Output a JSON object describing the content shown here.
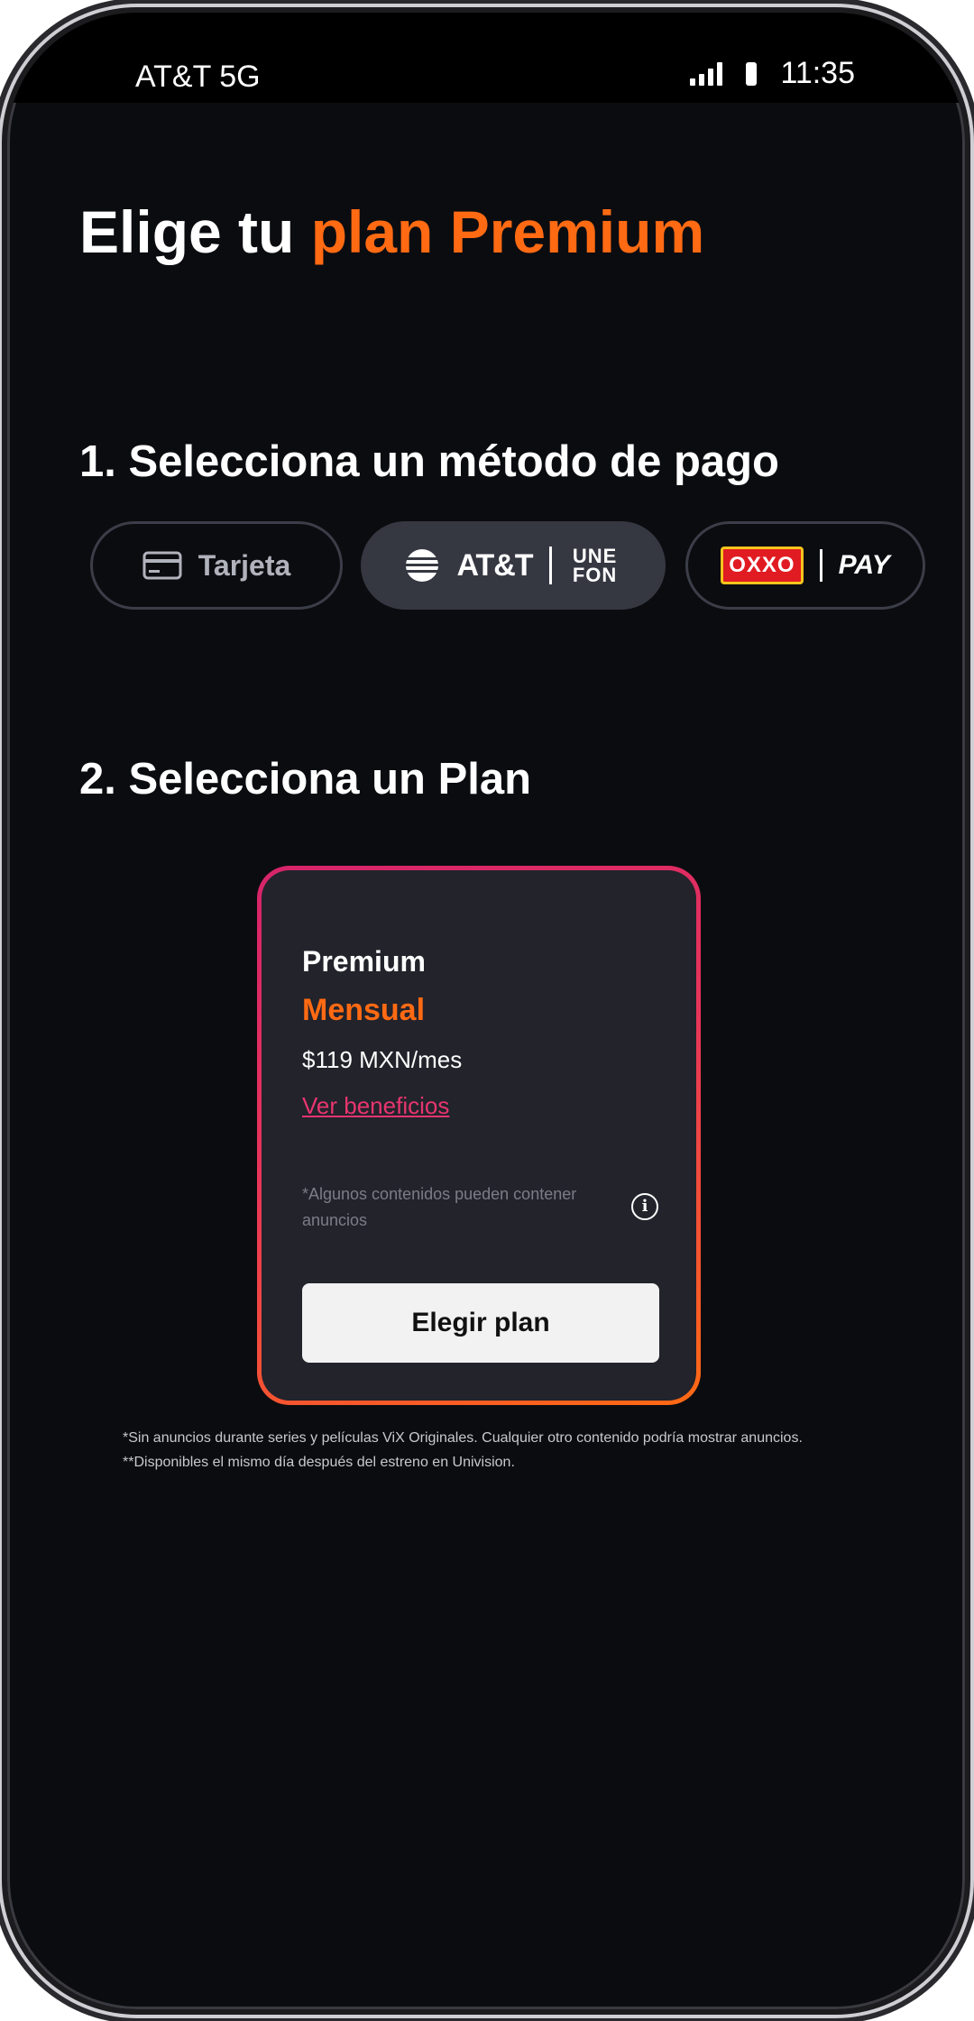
{
  "status_bar": {
    "carrier": "AT&T 5G",
    "time": "11:35"
  },
  "title": {
    "prefix": "Elige tu ",
    "accent": "plan Premium"
  },
  "step1": {
    "heading": "1. Selecciona un método de pago",
    "options": [
      {
        "label": "Tarjeta",
        "icon": "credit-card-icon",
        "selected": false
      },
      {
        "brand": "AT&T",
        "sub_brand": "UNE FON",
        "selected": true
      },
      {
        "brand": "OXXO",
        "sub_brand": "PAY",
        "selected": false
      }
    ]
  },
  "step2": {
    "heading": "2. Selecciona un Plan",
    "plan": {
      "name": "Premium",
      "period": "Mensual",
      "price": "$119 MXN/mes",
      "benefits_link": "Ver beneficios",
      "disclaimer": "*Algunos contenidos pueden contener anuncios",
      "cta": "Elegir plan"
    }
  },
  "footnotes": [
    "*Sin anuncios durante series y películas ViX Originales. Cualquier otro contenido podría mostrar anuncios.",
    "**Disponibles el mismo día después del estreno en Univision."
  ],
  "colors": {
    "accent": "#ff6a13",
    "link": "#e8356f",
    "background": "#0b0c10",
    "card": "#22232b"
  }
}
